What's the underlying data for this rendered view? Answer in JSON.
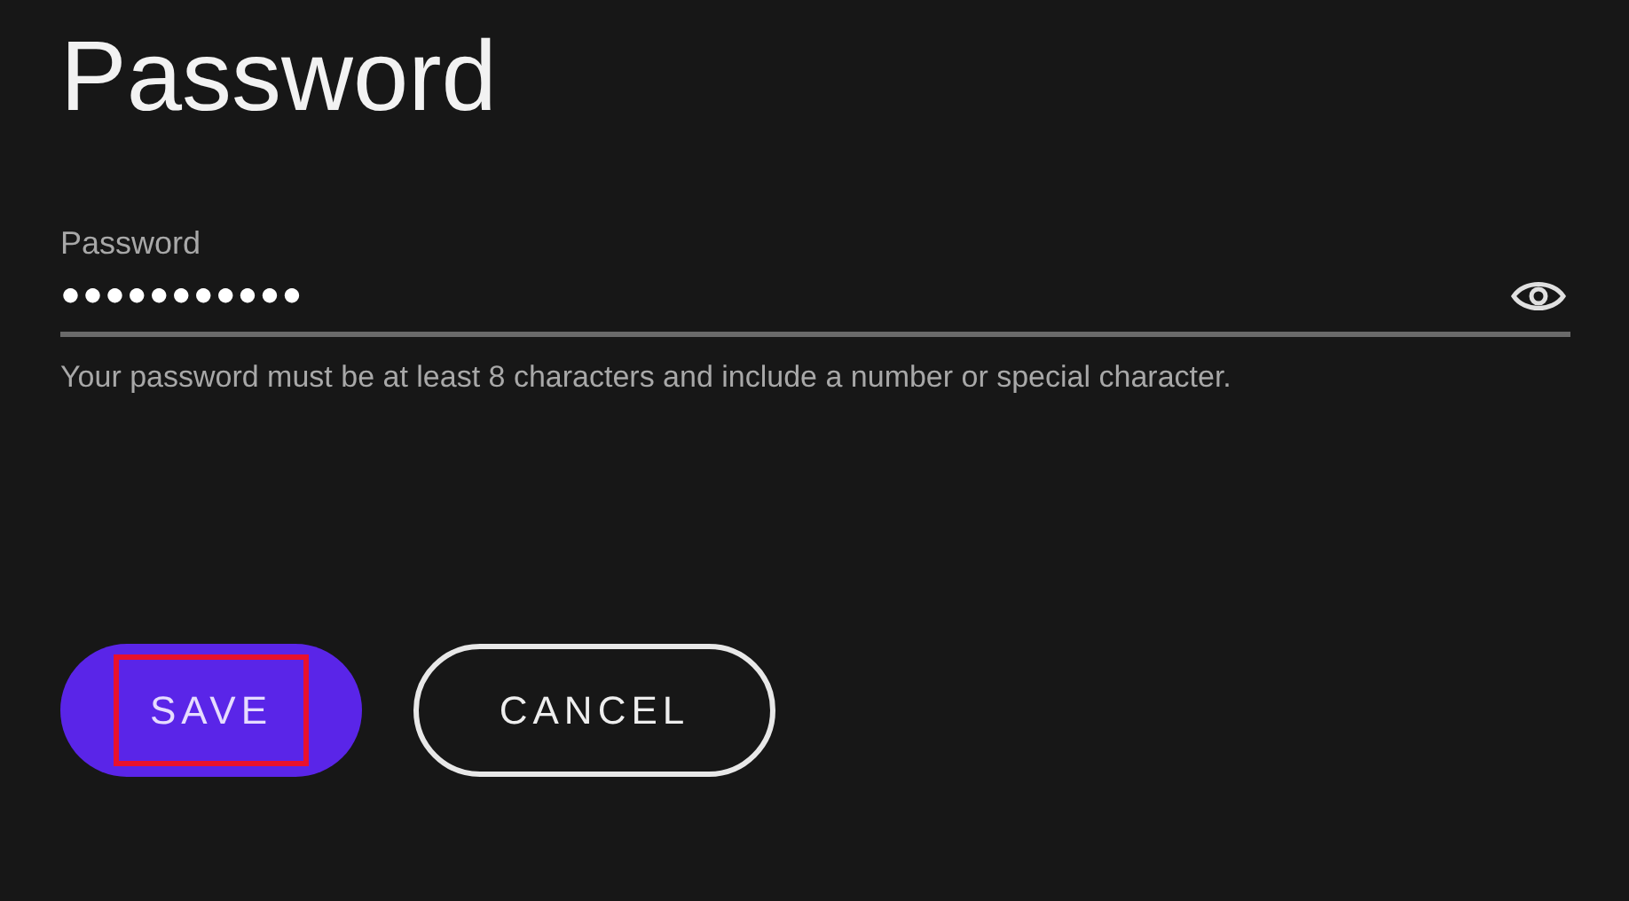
{
  "title": "Password",
  "field": {
    "label": "Password",
    "value": "●●●●●●●●●●●",
    "masked": true,
    "helper": "Your password must be at least 8 characters and include a number or special character."
  },
  "buttons": [
    {
      "label": "SAVE",
      "kind": "primary",
      "highlighted": true
    },
    {
      "label": "CANCEL",
      "kind": "outline",
      "highlighted": false
    }
  ]
}
